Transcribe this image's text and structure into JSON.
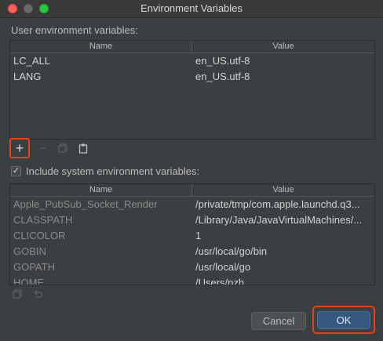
{
  "window": {
    "title": "Environment Variables"
  },
  "user_section": {
    "label": "User environment variables:",
    "columns": {
      "name": "Name",
      "value": "Value"
    },
    "rows": [
      {
        "name": "LC_ALL",
        "value": "en_US.utf-8"
      },
      {
        "name": "LANG",
        "value": "en_US.utf-8"
      }
    ],
    "toolbar": {
      "add": "+",
      "remove": "−"
    }
  },
  "include_system": {
    "label": "Include system environment variables:",
    "checked": true
  },
  "system_section": {
    "columns": {
      "name": "Name",
      "value": "Value"
    },
    "rows": [
      {
        "name": "Apple_PubSub_Socket_Render",
        "value": "/private/tmp/com.apple.launchd.q3..."
      },
      {
        "name": "CLASSPATH",
        "value": "/Library/Java/JavaVirtualMachines/..."
      },
      {
        "name": "CLICOLOR",
        "value": "1"
      },
      {
        "name": "GOBIN",
        "value": "/usr/local/go/bin"
      },
      {
        "name": "GOPATH",
        "value": "/usr/local/go"
      },
      {
        "name": "HOME",
        "value": "/Users/pzh"
      }
    ]
  },
  "buttons": {
    "cancel": "Cancel",
    "ok": "OK"
  },
  "colors": {
    "highlight": "#e0451e",
    "ok_button": "#365880",
    "background": "#3c3f41"
  }
}
